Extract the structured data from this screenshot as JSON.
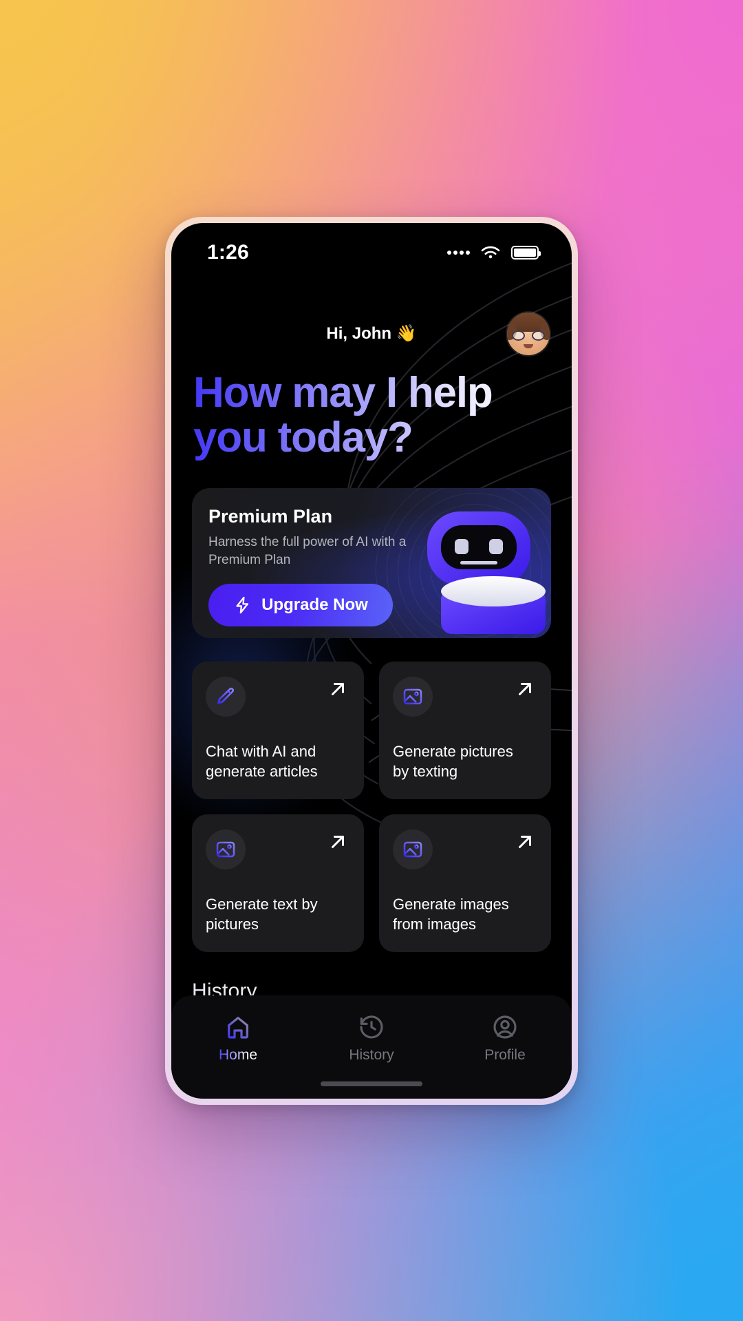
{
  "status_bar": {
    "time": "1:26",
    "signal_icon": "signal-dots-icon",
    "wifi_icon": "wifi-icon",
    "battery_icon": "battery-icon"
  },
  "header": {
    "greeting": "Hi, John 👋",
    "avatar_icon": "avatar"
  },
  "headline": "How may I help\nyou today?",
  "premium_card": {
    "title": "Premium Plan",
    "subtitle": "Harness the full power of AI with a\nPremium Plan",
    "cta_label": "Upgrade Now",
    "cta_icon": "lightning-bolt-icon",
    "illustration": "robot-illustration"
  },
  "features": [
    {
      "icon": "pencil-icon",
      "label": "Chat with AI and\ngenerate articles",
      "action_icon": "arrow-up-right-icon"
    },
    {
      "icon": "image-icon",
      "label": "Generate pictures\nby texting",
      "action_icon": "arrow-up-right-icon"
    },
    {
      "icon": "image-icon",
      "label": "Generate text by\npictures",
      "action_icon": "arrow-up-right-icon"
    },
    {
      "icon": "image-icon",
      "label": "Generate images\nfrom images",
      "action_icon": "arrow-up-right-icon"
    }
  ],
  "history_section": {
    "title": "History"
  },
  "bottom_nav": {
    "items": [
      {
        "label": "Home",
        "icon": "home-icon",
        "active": true
      },
      {
        "label": "History",
        "icon": "clock-rewind-icon",
        "active": false
      },
      {
        "label": "Profile",
        "icon": "user-circle-icon",
        "active": false
      }
    ]
  },
  "colors": {
    "accent": "#4F46E5",
    "accent_light": "#6F66F7",
    "card_bg": "#1C1C1F",
    "screen_bg": "#000000",
    "muted_text": "#777781"
  }
}
